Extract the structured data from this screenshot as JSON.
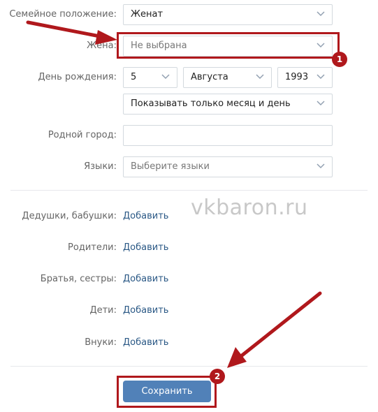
{
  "form": {
    "marital_status": {
      "label": "Семейное положение:",
      "value": "Женат"
    },
    "wife": {
      "label": "Жена:",
      "value": "Не выбрана"
    },
    "birthday": {
      "label": "День рождения:",
      "day": "5",
      "month": "Августа",
      "year": "1993",
      "visibility": "Показывать только месяц и день"
    },
    "hometown": {
      "label": "Родной город:",
      "value": ""
    },
    "languages": {
      "label": "Языки:",
      "placeholder": "Выберите языки"
    }
  },
  "relatives": {
    "add_label": "Добавить",
    "grandparents": {
      "label": "Дедушки, бабушки:"
    },
    "parents": {
      "label": "Родители:"
    },
    "siblings": {
      "label": "Братья, сестры:"
    },
    "children": {
      "label": "Дети:"
    },
    "grandchildren": {
      "label": "Внуки:"
    }
  },
  "save_button": {
    "label": "Сохранить"
  },
  "annotations": {
    "marker_1": "1",
    "marker_2": "2",
    "color": "#b0181c"
  },
  "watermark": "vkbaron.ru",
  "colors": {
    "link": "#2a5885",
    "button": "#5181b8",
    "label": "#656565",
    "border": "#d3d9de"
  }
}
